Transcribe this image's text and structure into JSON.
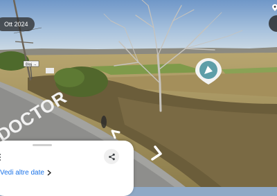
{
  "viewer": {
    "capture_date": "Ott 2024",
    "colors": {
      "accent": "#1a73e8",
      "marker": "#5e9ea8",
      "chip_bg": "#303030"
    }
  },
  "scene": {
    "road_marking_text": "DOCTOR",
    "road_sign_text": "Blaj →"
  },
  "markers": [
    {
      "icon": "place-pin-icon"
    }
  ],
  "navigation": {
    "arrows": [
      {
        "icon": "chevron-left-icon"
      },
      {
        "icon": "chevron-down-right-icon"
      }
    ]
  },
  "bottom_sheet": {
    "see_other_dates": "Vedi altre date",
    "icons": [
      "more-vert-icon",
      "share-icon",
      "chevron-right-icon"
    ]
  }
}
